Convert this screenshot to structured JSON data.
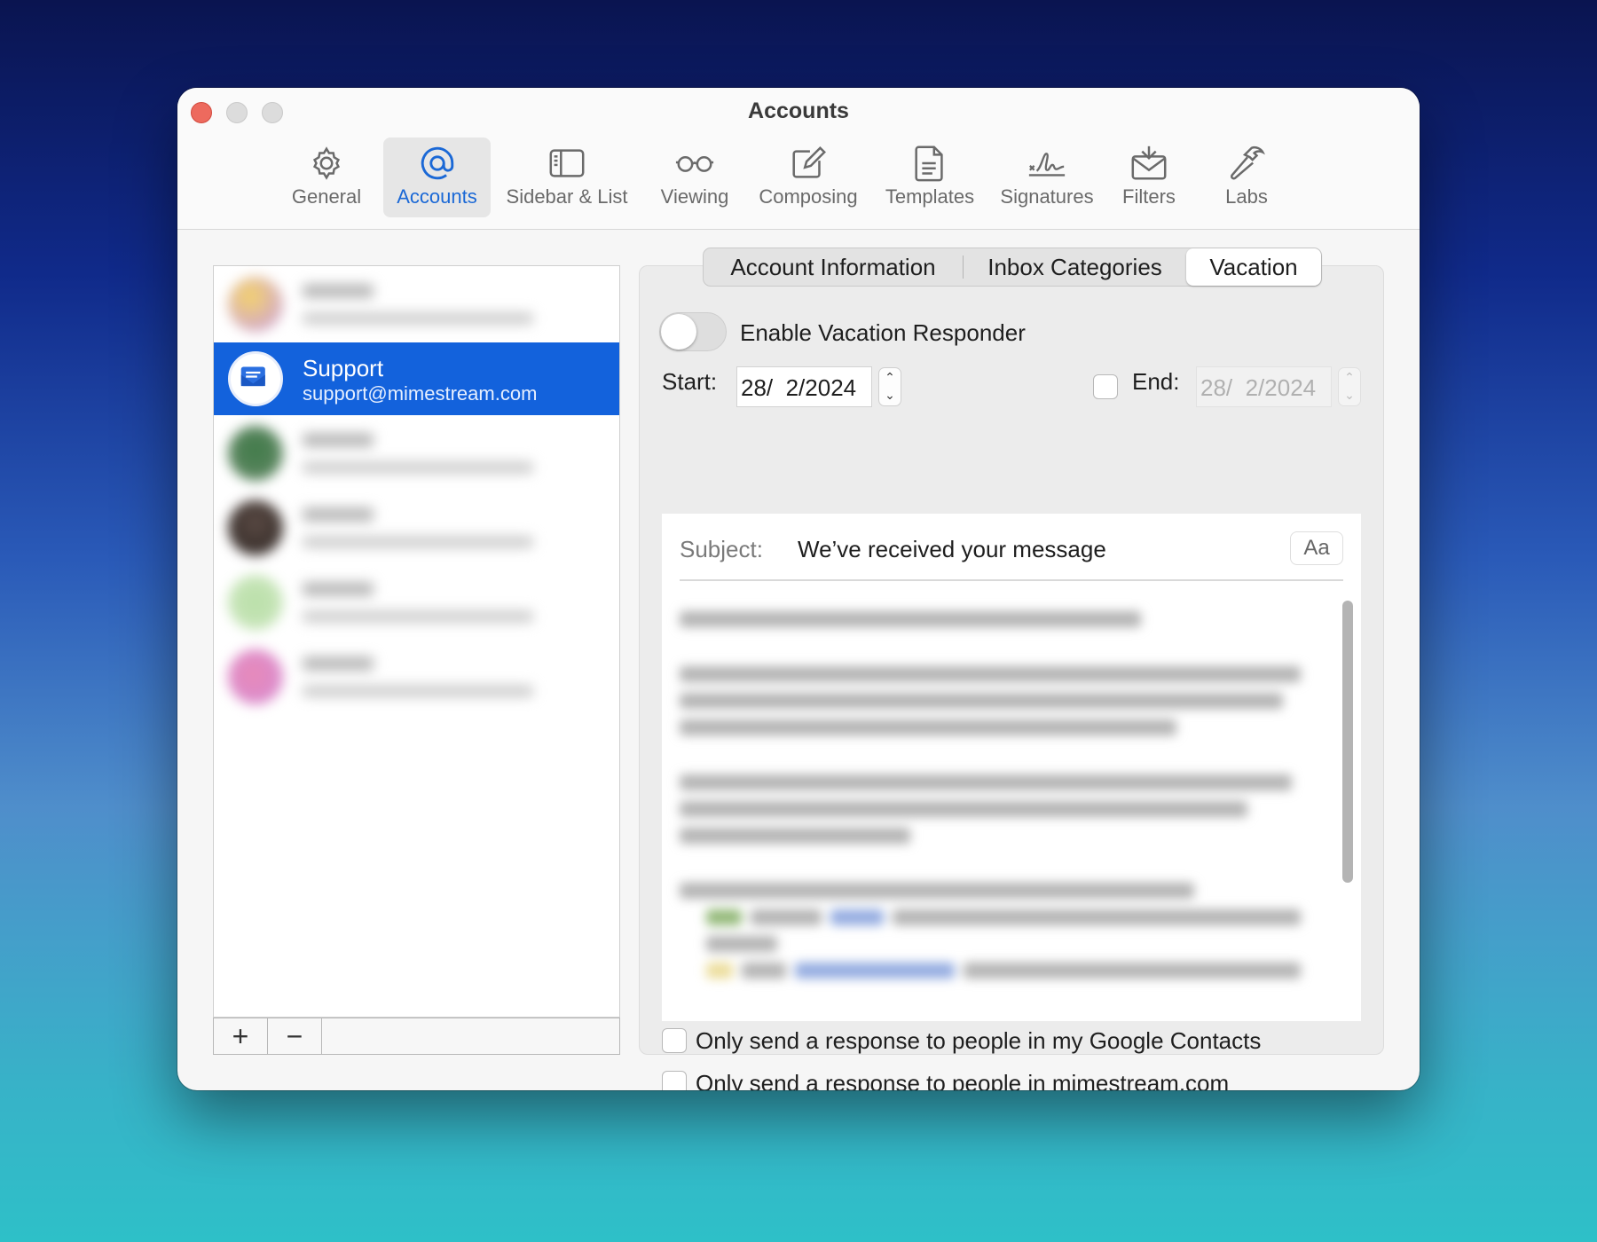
{
  "window": {
    "title": "Accounts"
  },
  "toolbar": [
    {
      "label": "General",
      "icon": "gear-icon"
    },
    {
      "label": "Accounts",
      "icon": "at-sign-icon",
      "active": true
    },
    {
      "label": "Sidebar & List",
      "icon": "sidebar-icon"
    },
    {
      "label": "Viewing",
      "icon": "glasses-icon"
    },
    {
      "label": "Composing",
      "icon": "compose-icon"
    },
    {
      "label": "Templates",
      "icon": "document-icon"
    },
    {
      "label": "Signatures",
      "icon": "signature-icon"
    },
    {
      "label": "Filters",
      "icon": "envelope-filter-icon"
    },
    {
      "label": "Labs",
      "icon": "hammer-icon"
    }
  ],
  "accounts": {
    "selected": {
      "name": "Support",
      "email": "support@mimestream.com"
    },
    "footer": {
      "add": "+",
      "remove": "−"
    }
  },
  "tabs": {
    "items": [
      "Account Information",
      "Inbox Categories",
      "Vacation"
    ],
    "active": "Vacation"
  },
  "vacation": {
    "enable_label": "Enable Vacation Responder",
    "enabled": false,
    "start_label": "Start:",
    "start_value": "28/  2/2024",
    "end_label": "End:",
    "end_value": "28/  2/2024",
    "end_checked": false,
    "subject_label": "Subject:",
    "subject_value": "We’ve received your message",
    "format_button": "Aa",
    "option_contacts": "Only send a response to people in my Google Contacts",
    "option_domain": "Only send a response to people in mimestream.com"
  },
  "colors": {
    "accent": "#1362dc",
    "close": "#ed6a5e",
    "window_bg": "#f6f6f6"
  }
}
